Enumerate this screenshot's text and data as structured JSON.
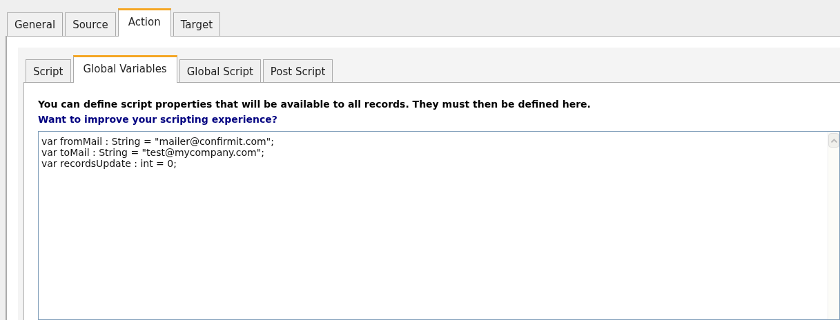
{
  "outer_tabs": [
    {
      "label": "General",
      "selected": false
    },
    {
      "label": "Source",
      "selected": false
    },
    {
      "label": "Action",
      "selected": true
    },
    {
      "label": "Target",
      "selected": false
    }
  ],
  "inner_tabs": [
    {
      "label": "Script",
      "selected": false
    },
    {
      "label": "Global Variables",
      "selected": true
    },
    {
      "label": "Global Script",
      "selected": false
    },
    {
      "label": "Post Script",
      "selected": false
    }
  ],
  "description": "You can define script properties that will be available to all records. They must then be defined here.",
  "help_link": "Want to improve your scripting experience?",
  "editor": {
    "lines": [
      "var fromMail : String = \"mailer@confirmit.com\";",
      "var toMail : String = \"test@mycompany.com\";",
      "var recordsUpdate : int = 0;"
    ]
  }
}
